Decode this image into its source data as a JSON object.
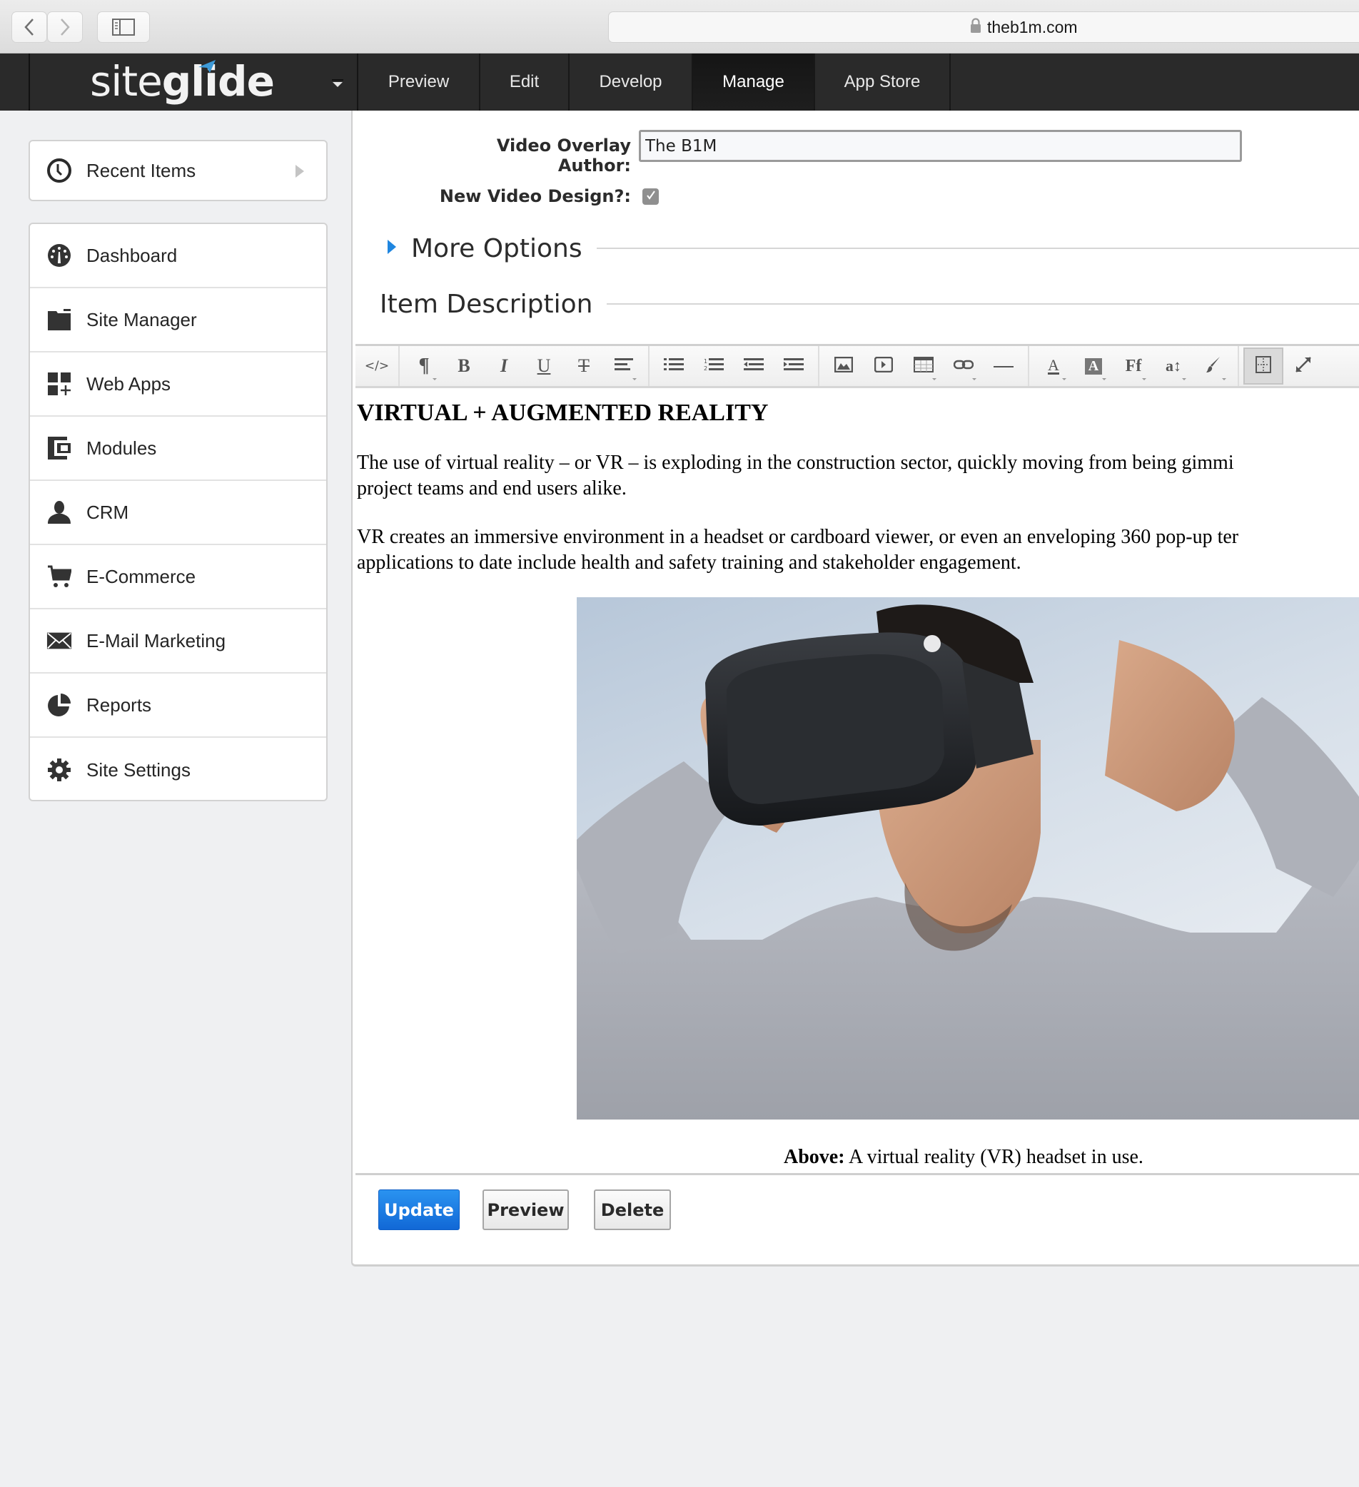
{
  "browser": {
    "url": "theb1m.com",
    "back_icon": "chevron-left-icon",
    "forward_icon": "chevron-right-icon",
    "sidebar_toggle_icon": "sidebar-icon",
    "lock_icon": "lock-icon"
  },
  "app": {
    "logo_light": "site",
    "logo_bold": "glide",
    "brand_color": "#3d9ad8",
    "nav_tabs": [
      {
        "label": "Preview",
        "active": false
      },
      {
        "label": "Edit",
        "active": false
      },
      {
        "label": "Develop",
        "active": false
      },
      {
        "label": "Manage",
        "active": true
      },
      {
        "label": "App Store",
        "active": false
      }
    ]
  },
  "sidebar": {
    "recent": {
      "label": "Recent Items",
      "icon": "clock-icon"
    },
    "items": [
      {
        "label": "Dashboard",
        "icon": "dashboard-icon"
      },
      {
        "label": "Site Manager",
        "icon": "folder-icon"
      },
      {
        "label": "Web Apps",
        "icon": "web-apps-icon"
      },
      {
        "label": "Modules",
        "icon": "modules-icon"
      },
      {
        "label": "CRM",
        "icon": "user-icon"
      },
      {
        "label": "E-Commerce",
        "icon": "cart-icon"
      },
      {
        "label": "E-Mail Marketing",
        "icon": "envelope-icon"
      },
      {
        "label": "Reports",
        "icon": "pie-chart-icon"
      },
      {
        "label": "Site Settings",
        "icon": "gear-icon"
      }
    ]
  },
  "form": {
    "author_label": "Video Overlay Author:",
    "author_value": "The B1M",
    "new_design_label": "New Video Design?:",
    "new_design_checked": true,
    "more_options": "More Options",
    "item_description": "Item Description"
  },
  "toolbar": {
    "groups": [
      [
        "html-icon"
      ],
      [
        "paragraph-icon",
        "bold-icon",
        "italic-icon",
        "underline-icon",
        "strikethrough-icon",
        "align-icon"
      ],
      [
        "unordered-list-icon",
        "ordered-list-icon",
        "outdent-icon",
        "indent-icon"
      ],
      [
        "image-icon",
        "video-icon",
        "table-icon",
        "link-icon",
        "horizontal-rule-icon"
      ],
      [
        "font-color-icon",
        "background-color-icon",
        "font-family-icon",
        "font-size-icon",
        "format-brush-icon"
      ],
      [
        "show-blocks-icon",
        "fullscreen-icon"
      ]
    ]
  },
  "content": {
    "heading": "VIRTUAL + AUGMENTED REALITY",
    "p1_line1": "The use of virtual reality – or VR – is exploding in the construction sector, quickly moving from being gimmi",
    "p1_line2": "project teams and end users alike.",
    "p2_line1": "VR creates an immersive environment in a headset or cardboard viewer, or even an enveloping 360 pop-up ter",
    "p2_line2": "applications to date include health and safety training and stakeholder engagement.",
    "image_alt": "Man wearing a VR headset",
    "caption_bold": "Above:",
    "caption_text": " A virtual reality (VR) headset in use."
  },
  "actions": {
    "update": "Update",
    "preview": "Preview",
    "delete": "Delete",
    "primary_color": "#1a7be3"
  }
}
